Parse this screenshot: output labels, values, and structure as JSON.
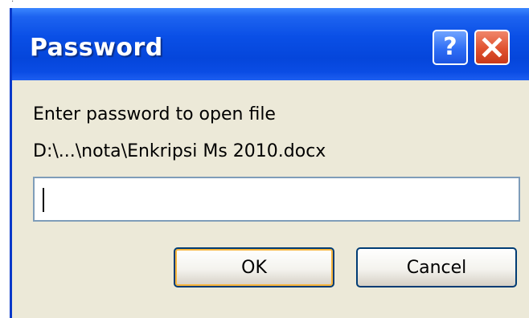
{
  "dialog": {
    "title": "Password",
    "help_glyph": "?",
    "close_icon": "close-x-icon",
    "prompt_line_1": "Enter password to open file",
    "prompt_line_2": "D:\\...\\nota\\Enkripsi Ms 2010.docx",
    "password_value": "",
    "ok_label": "OK",
    "cancel_label": "Cancel"
  },
  "colors": {
    "titlebar": "#0546db",
    "client": "#ece9d8",
    "close_button": "#e0512f",
    "help_button": "#2f6ef5"
  }
}
